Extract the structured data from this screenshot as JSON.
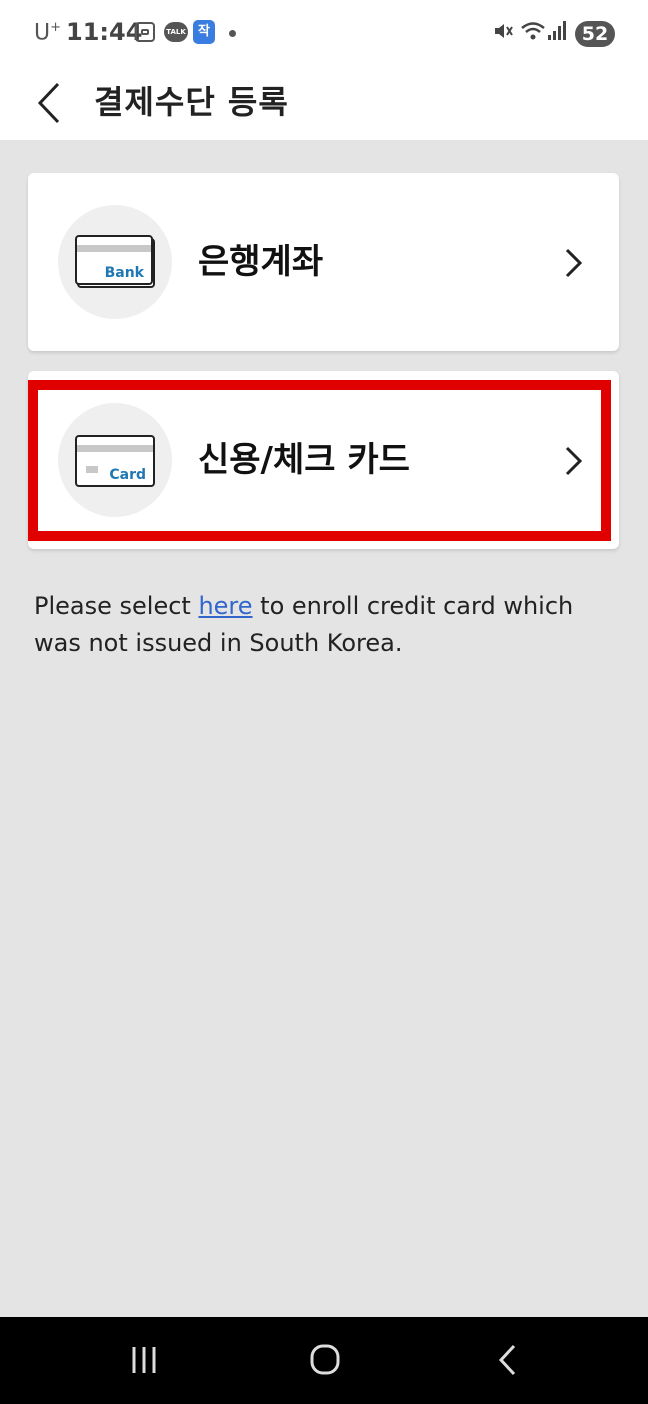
{
  "status_bar": {
    "carrier": "U",
    "carrier_sup": "+",
    "time": "11:44",
    "talk_badge": "TALK",
    "app_badge": "작",
    "battery": "52"
  },
  "header": {
    "title": "결제수단 등록"
  },
  "options": [
    {
      "label": "은행계좌",
      "icon_text": "Bank",
      "icon": "bank-card-icon"
    },
    {
      "label": "신용/체크 카드",
      "icon_text": "Card",
      "icon": "credit-card-icon"
    }
  ],
  "notice": {
    "prefix": "Please select ",
    "link": "here",
    "suffix": " to enroll credit card which was not issued in South Korea."
  },
  "colors": {
    "highlight": "#e00000",
    "link": "#3266cc",
    "accent_blue": "#1f78b4"
  }
}
